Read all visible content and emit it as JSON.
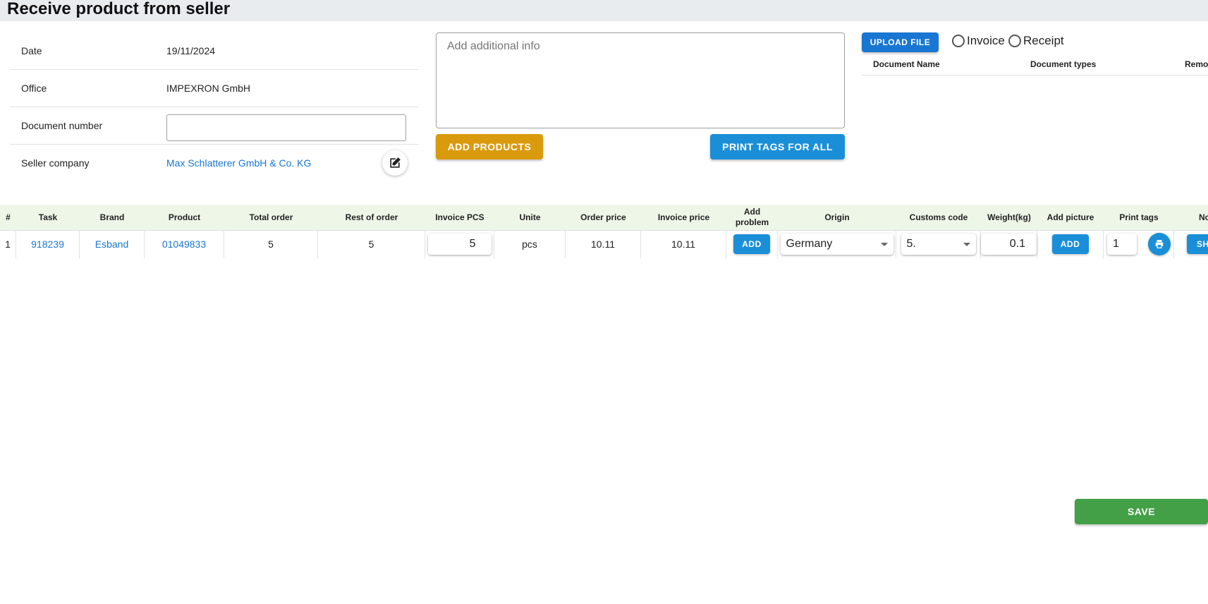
{
  "page": {
    "title": "Receive product from seller"
  },
  "info": {
    "date_label": "Date",
    "date_value": "19/11/2024",
    "office_label": "Office",
    "office_value": "IMPEXRON GmbH",
    "docnum_label": "Document number",
    "docnum_value": "",
    "seller_label": "Seller company",
    "seller_value": "Max Schlatterer GmbH & Co. KG"
  },
  "notes": {
    "placeholder": "Add additional info",
    "value": ""
  },
  "actions": {
    "add_products": "ADD PRODUCTS",
    "print_tags_all": "PRINT TAGS FOR ALL",
    "upload_file": "UPLOAD FILE",
    "save": "SAVE"
  },
  "doc_type": {
    "options": [
      "Invoice",
      "Receipt"
    ],
    "selected": null
  },
  "documents": {
    "headers": [
      "Document Name",
      "Document types",
      "Remo"
    ]
  },
  "grid": {
    "headers": [
      "#",
      "Task",
      "Brand",
      "Product",
      "Total order",
      "Rest of order",
      "Invoice PCS",
      "Unite",
      "Order price",
      "Invoice price",
      "Add problem",
      "Origin",
      "Customs code",
      "Weight(kg)",
      "Add picture",
      "Print tags",
      "Nc"
    ],
    "rows": [
      {
        "num": "1",
        "task": "918239",
        "brand": "Esband",
        "product": "01049833",
        "total_order": "5",
        "rest_of_order": "5",
        "invoice_pcs": "5",
        "unit": "pcs",
        "order_price": "10.11",
        "invoice_price": "10.11",
        "add_problem_label": "ADD",
        "origin": "Germany",
        "customs_code": "5.",
        "weight": "0.1",
        "add_picture_label": "ADD",
        "print_tags_qty": "1",
        "note_button_label": "SH"
      }
    ]
  },
  "colors": {
    "accent_blue": "#1a8fd8",
    "orange": "#d99a0d",
    "green": "#43a047",
    "link": "#1976d2",
    "header_bg": "#e9ecef",
    "grid_head_bg": "#eef6e8"
  }
}
